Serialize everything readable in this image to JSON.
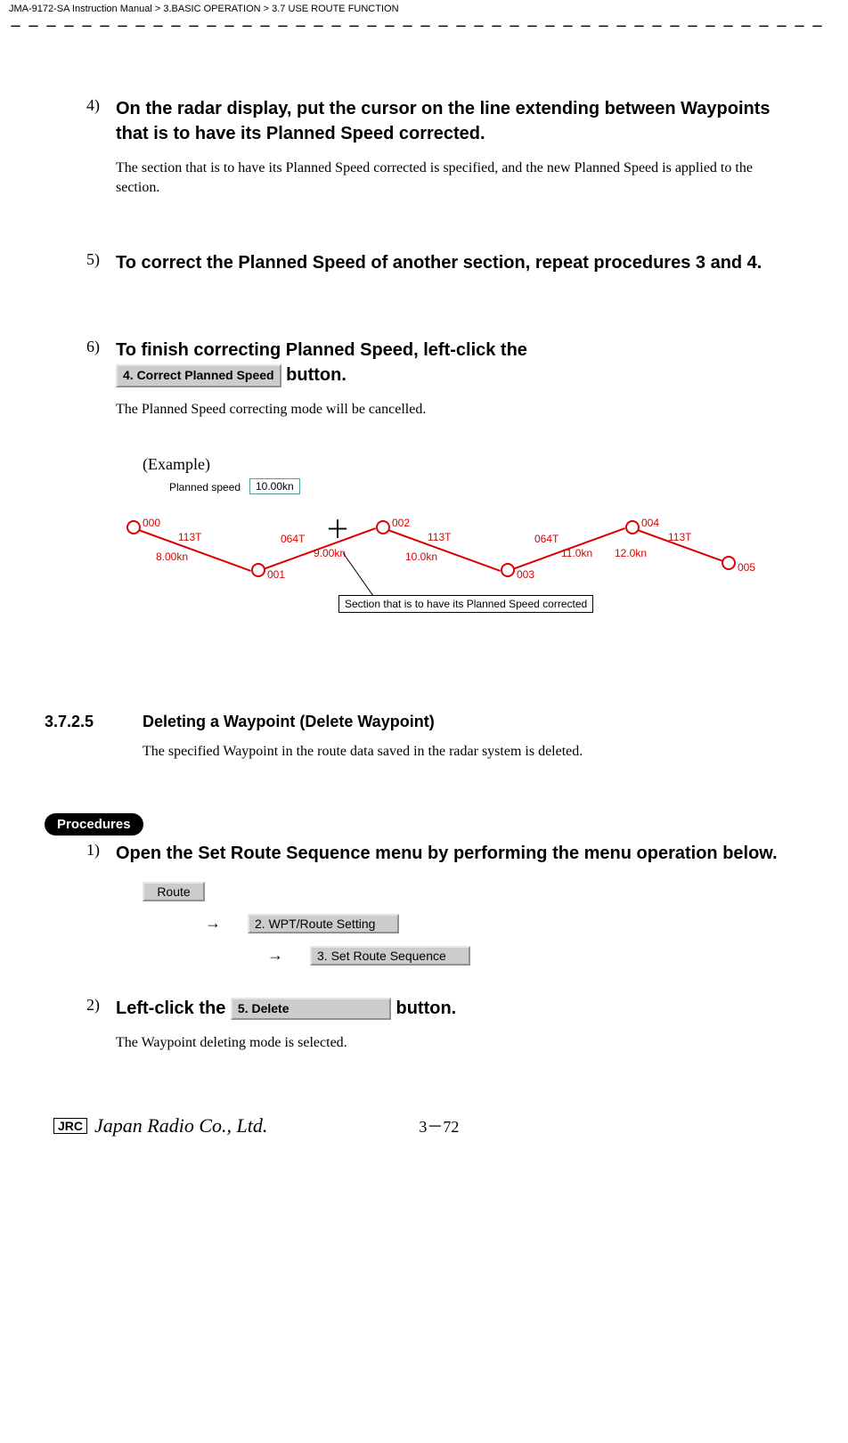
{
  "header": {
    "manual": "JMA-9172-SA Instruction Manual",
    "chapter": "3.BASIC OPERATION",
    "section": "3.7  USE ROUTE FUNCTION"
  },
  "steps": [
    {
      "num": "4)",
      "title": "On the radar display, put the cursor on the line extending between Waypoints that is to have its Planned Speed corrected.",
      "desc": "The section that is to have its Planned Speed corrected is specified, and the new Planned Speed is applied to the section."
    },
    {
      "num": "5)",
      "title": "To correct the Planned Speed of another section, repeat procedures 3 and 4.",
      "desc": ""
    },
    {
      "num": "6)",
      "title_pre": "To finish correcting Planned Speed, left-click the ",
      "button_label": "4. Correct Planned Speed",
      "title_post": "  button.",
      "desc": "The Planned Speed correcting mode will be cancelled."
    }
  ],
  "example": {
    "label": "(Example)",
    "planned_label": "Planned speed",
    "planned_value": "10.00kn",
    "caption": "Section that is to have its Planned Speed corrected",
    "waypoints": [
      "000",
      "001",
      "002",
      "003",
      "004",
      "005"
    ],
    "headings": [
      "113T",
      "064T",
      "113T",
      "064T",
      "113T"
    ],
    "speeds": [
      "8.00kn",
      "9.00kn",
      "10.0kn",
      "11.0kn",
      "12.0kn"
    ]
  },
  "subsection": {
    "num": "3.7.2.5",
    "title": "Deleting a Waypoint (Delete Waypoint)",
    "desc": "The specified Waypoint in the route data saved in the radar system is deleted."
  },
  "procedures_label": "Procedures",
  "proc_steps": [
    {
      "num": "1)",
      "title": "Open the Set Route Sequence menu by performing the menu operation below."
    },
    {
      "num": "2)",
      "title_pre": "Left-click the  ",
      "button_label": "5. Delete",
      "title_post": "  button.",
      "desc": "The Waypoint deleting mode is selected."
    }
  ],
  "menu": {
    "route": "Route",
    "wpt": "2. WPT/Route Setting",
    "seq": "3. Set Route Sequence"
  },
  "footer": {
    "jrc": "JRC",
    "company": "Japan Radio Co., Ltd.",
    "page": "3－72"
  }
}
